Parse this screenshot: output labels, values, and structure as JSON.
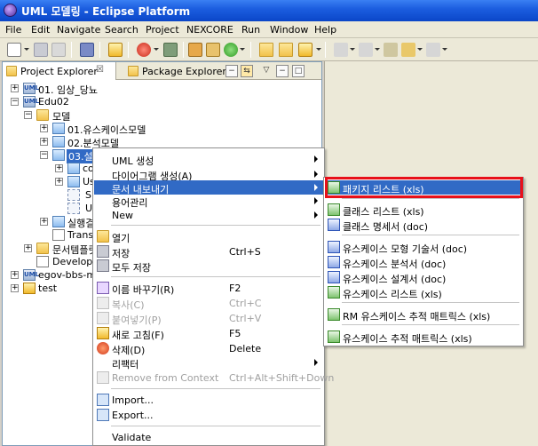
{
  "window": {
    "title": "UML 모델링 - Eclipse Platform"
  },
  "menubar": [
    "File",
    "Edit",
    "Navigate",
    "Search",
    "Project",
    "NEXCORE",
    "Run",
    "Window",
    "Help"
  ],
  "tabs": {
    "active": "Project Explorer",
    "inactive": "Package Explorer",
    "close_glyph": "☒"
  },
  "tree": [
    {
      "label": "01. 임상_당뇨"
    },
    {
      "label": "Edu02"
    },
    {
      "label": "모델"
    },
    {
      "label": "01.유스케이스모델"
    },
    {
      "label": "02.분석모델"
    },
    {
      "label": "03.설계모델"
    },
    {
      "label": "co"
    },
    {
      "label": "Us"
    },
    {
      "label": "SI"
    },
    {
      "label": "UI"
    },
    {
      "label": "실행결"
    },
    {
      "label": "Trans"
    },
    {
      "label": "문서템플릿"
    },
    {
      "label": "Develope"
    },
    {
      "label": "egov-bbs-m"
    },
    {
      "label": "test"
    }
  ],
  "context_menu": {
    "items": [
      {
        "label": "UML 생성"
      },
      {
        "label": "다이어그램 생성(A)"
      },
      {
        "label": "문서 내보내기"
      },
      {
        "label": "용어관리"
      },
      {
        "label": "New"
      },
      {
        "label": "열기"
      },
      {
        "label": "저장",
        "shortcut": "Ctrl+S"
      },
      {
        "label": "모두 저장"
      },
      {
        "label": "이름 바꾸기(R)",
        "shortcut": "F2"
      },
      {
        "label": "복사(C)",
        "shortcut": "Ctrl+C"
      },
      {
        "label": "붙여넣기(P)",
        "shortcut": "Ctrl+V"
      },
      {
        "label": "새로 고침(F)",
        "shortcut": "F5"
      },
      {
        "label": "삭제(D)",
        "shortcut": "Delete"
      },
      {
        "label": "리팩터"
      },
      {
        "label": "Remove from Context",
        "shortcut": "Ctrl+Alt+Shift+Down"
      },
      {
        "label": "Import..."
      },
      {
        "label": "Export..."
      },
      {
        "label": "Validate"
      }
    ]
  },
  "submenu": {
    "items": [
      {
        "label": "패키지 리스트 (xls)"
      },
      {
        "label": "클래스 리스트 (xls)"
      },
      {
        "label": "클래스 명세서 (doc)"
      },
      {
        "label": "유스케이스 모형 기술서 (doc)"
      },
      {
        "label": "유스케이스 분석서 (doc)"
      },
      {
        "label": "유스케이스 설계서 (doc)"
      },
      {
        "label": "유스케이스 리스트 (xls)"
      },
      {
        "label": "RM 유스케이스 추적 매트릭스 (xls)"
      },
      {
        "label": "유스케이스 추적 매트릭스 (xls)"
      }
    ]
  },
  "colors": {
    "selection": "#316ac5",
    "highlight_border": "#e8101a",
    "title_bar": "#0a46c8"
  }
}
